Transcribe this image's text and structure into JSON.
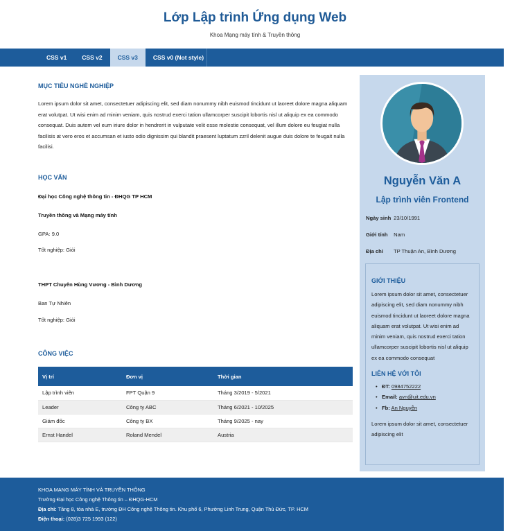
{
  "header": {
    "title": "Lớp Lập trình Ứng dụng Web",
    "subtitle": "Khoa Mạng máy tính & Truyền thông"
  },
  "nav": {
    "items": [
      {
        "label": "CSS v1"
      },
      {
        "label": "CSS v2"
      },
      {
        "label": "CSS v3",
        "active": true
      },
      {
        "label": "CSS v0 (Not style)"
      }
    ]
  },
  "career": {
    "title": "MỤC TIÊU NGHỀ NGHIỆP",
    "text": "Lorem ipsum dolor sit amet, consectetuer adipiscing elit, sed diam nonummy nibh euismod tincidunt ut laoreet dolore magna aliquam erat volutpat. Ut wisi enim ad minim veniam, quis nostrud exerci tation ullamcorper suscipit lobortis nisl ut aliquip ex ea commodo consequat. Duis autem vel eum iriure dolor in hendrerit in vulputate velit esse molestie consequat, vel illum dolore eu feugiat nulla facilisis at vero eros et accumsan et iusto odio dignissim qui blandit praesent luptatum zzril delenit augue duis dolore te feugait nulla facilisi."
  },
  "education": {
    "title": "HỌC VẤN",
    "university": "Đại học Công nghệ thông tin - ĐHQG TP HCM",
    "major": "Truyền thông và Mạng máy tính",
    "gpa": "GPA: 9.0",
    "grad1": "Tốt nghiệp: Giỏi",
    "highschool": "THPT Chuyên Hùng Vương - Bình Dương",
    "track": "Ban Tự Nhiên",
    "grad2": "Tốt nghiệp: Giỏi"
  },
  "jobs": {
    "title": "CÔNG VIỆC",
    "headers": [
      "Vị trí",
      "Đơn vị",
      "Thời gian"
    ],
    "rows": [
      [
        "Lập trình viên",
        "FPT Quận 9",
        "Tháng 3/2019 - 5/2021"
      ],
      [
        "Leader",
        "Công ty ABC",
        "Tháng 6/2021 - 10/2025"
      ],
      [
        "Giám đốc",
        "Công ty BX",
        "Tháng 9/2025 - nay"
      ],
      [
        "Ernst Handel",
        "Roland Mendel",
        "Austria"
      ]
    ]
  },
  "profile": {
    "name": "Nguyễn Văn A",
    "role": "Lập trình viên Frontend",
    "birth_label": "Ngày sinh",
    "birth": "23/10/1991",
    "gender_label": "Giới tính",
    "gender": "Nam",
    "address_label": "Địa chỉ",
    "address": "TP Thuận An, Bình Dương"
  },
  "about": {
    "title": "GIỚI THIỆU",
    "text": "Lorem ipsum dolor sit amet, consectetuer adipiscing elit, sed diam nonummy nibh euismod tincidunt ut laoreet dolore magna aliquam erat volutpat. Ut wisi enim ad minim veniam, quis nostrud exerci tation ullamcorper suscipit lobortis nisl ut aliquip ex ea commodo consequat"
  },
  "contact": {
    "title": "LIÊN HỆ VỚI TÔI",
    "bullet": "•",
    "phone_label": "ĐT:",
    "phone": "0984752222",
    "email_label": "Email:",
    "email": "avn@uit.edu.vn",
    "fb_label": "Fb:",
    "fb": "An Nguyễn",
    "text": "Lorem ipsum dolor sit amet, consectetuer adipiscing elit"
  },
  "footer": {
    "org": "KHOA MẠNG MÁY TÍNH VÀ TRUYỀN THÔNG",
    "school": "Trường Đại học Công nghệ Thông tin – ĐHQG-HCM",
    "address_label": "Địa chỉ:",
    "address": "Tầng 8, tòa nhà E, trường ĐH Công nghệ Thông tin. Khu phố 6, Phường Linh Trung, Quận Thủ Đức, TP. HCM",
    "phone_label": "Điện thoại:",
    "phone": "(028)3 725 1993 (122)"
  },
  "colors": {
    "primary": "#1d5c9b",
    "sidebar": "#c6d8ec",
    "active_tab": "#c6d8ec"
  }
}
